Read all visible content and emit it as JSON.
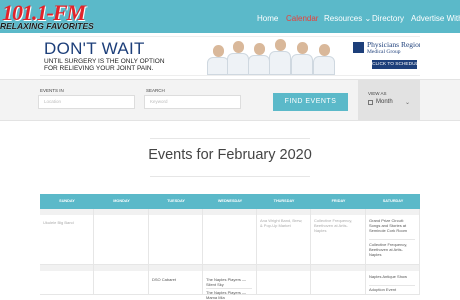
{
  "site": {
    "logo_main": "101.1-FM",
    "logo_sub": "RELAXING FAVORITES"
  },
  "nav": {
    "items": [
      {
        "label": "Home"
      },
      {
        "label": "Calendar"
      },
      {
        "label": "Resources ⌄"
      },
      {
        "label": "Directory"
      },
      {
        "label": "Advertise With Us"
      }
    ],
    "active_index": 1
  },
  "banner": {
    "headline": "DON'T WAIT",
    "line1": "UNTIL SURGERY IS THE ONLY OPTION",
    "line2": "FOR RELIEVING YOUR JOINT PAIN.",
    "org_name": "Physicians Regional",
    "org_sub": "Medical Group",
    "cta": "CLICK TO SCHEDULE"
  },
  "filter": {
    "events_in_label": "Events In",
    "events_in_placeholder": "Location",
    "search_label": "Search",
    "search_placeholder": "Keyword",
    "button": "FIND EVENTS",
    "view_as_label": "View As",
    "view_as_value": "Month",
    "calendar_icon": "calendar-icon",
    "chevron_icon": "chevron-down-icon"
  },
  "page_title": "Events for February 2020",
  "calendar": {
    "days": [
      "SUNDAY",
      "MONDAY",
      "TUESDAY",
      "WEDNESDAY",
      "THURSDAY",
      "FRIDAY",
      "SATURDAY"
    ],
    "week1_events": {
      "sunday": [
        "Ukulele Big Band"
      ],
      "thursday": [
        "Ana Wright Band, Brew, & Pop-Up Market"
      ],
      "friday": [
        "Collective Frequency, Beethoven at Artis-Naples"
      ],
      "saturday": [
        "Grand Prize Circuit: Songs and Stories at Seminole Cork Room",
        "Collective Frequency, Beethoven at Artis-Naples"
      ]
    },
    "week2_events": {
      "tuesday": [
        "DSO Cabaret"
      ],
      "wednesday": [
        "The Naples Players — Silent Sky",
        "The Naples Players — Mama Mia"
      ],
      "saturday": [
        "Naples Antique Show",
        "Adoption Event"
      ]
    }
  },
  "colors": {
    "brand": "#5bb9c9",
    "accent": "#e8403a",
    "navy": "#1d3f7a"
  }
}
